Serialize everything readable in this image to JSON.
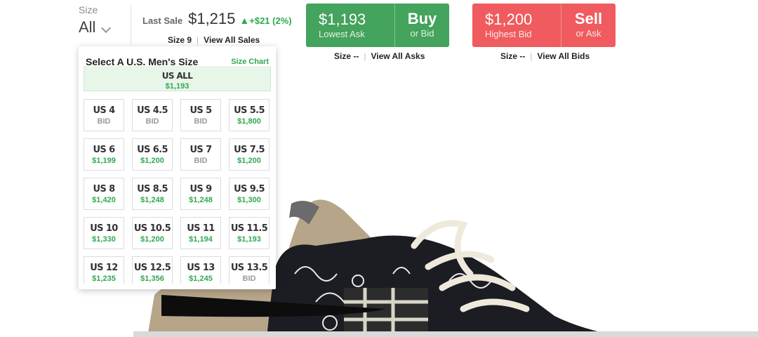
{
  "size_selector": {
    "label": "Size",
    "value": "All"
  },
  "last_sale": {
    "label": "Last Sale",
    "price": "$1,215",
    "change": "+$21 (2%)",
    "size": "Size 9",
    "link": "View All Sales"
  },
  "buy": {
    "price": "$1,193",
    "price_label": "Lowest Ask",
    "action": "Buy",
    "action_sub": "or Bid",
    "size": "Size --",
    "link": "View All Asks"
  },
  "sell": {
    "price": "$1,200",
    "price_label": "Highest Bid",
    "action": "Sell",
    "action_sub": "or Ask",
    "size": "Size --",
    "link": "View All Bids"
  },
  "dropdown": {
    "title": "Select A U.S. Men's Size",
    "size_chart": "Size Chart",
    "all": {
      "size": "US ALL",
      "price": "$1,193"
    },
    "sizes": [
      {
        "size": "US 4",
        "price": "BID"
      },
      {
        "size": "US 4.5",
        "price": "BID"
      },
      {
        "size": "US 5",
        "price": "BID"
      },
      {
        "size": "US 5.5",
        "price": "$1,800"
      },
      {
        "size": "US 6",
        "price": "$1,199"
      },
      {
        "size": "US 6.5",
        "price": "$1,200"
      },
      {
        "size": "US 7",
        "price": "BID"
      },
      {
        "size": "US 7.5",
        "price": "$1,200"
      },
      {
        "size": "US 8",
        "price": "$1,420"
      },
      {
        "size": "US 8.5",
        "price": "$1,248"
      },
      {
        "size": "US 9",
        "price": "$1,248"
      },
      {
        "size": "US 9.5",
        "price": "$1,300"
      },
      {
        "size": "US 10",
        "price": "$1,330"
      },
      {
        "size": "US 10.5",
        "price": "$1,200"
      },
      {
        "size": "US 11",
        "price": "$1,194"
      },
      {
        "size": "US 11.5",
        "price": "$1,193"
      },
      {
        "size": "US 12",
        "price": "$1,235"
      },
      {
        "size": "US 12.5",
        "price": "$1,356"
      },
      {
        "size": "US 13",
        "price": "$1,245"
      },
      {
        "size": "US 13.5",
        "price": "BID"
      }
    ]
  },
  "colors": {
    "buy": "#44a35c",
    "sell": "#ef5b5e",
    "accent": "#2fa84f"
  }
}
